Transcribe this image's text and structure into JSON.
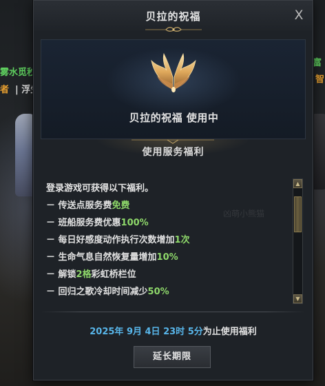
{
  "world": {
    "text_green_left": "雾水觅秒",
    "text_orange_left": "者",
    "text_sep_left": "| 浮生",
    "text_green_right": "富",
    "text_orange_right": "智"
  },
  "dialog": {
    "title": "贝拉的祝福",
    "close_label": "X",
    "banner": {
      "icon": "angel-wings-icon",
      "status": "贝拉的祝福 使用中"
    },
    "section_title": "使用服务福利",
    "watermark": "凶萌小熊猫",
    "benefits_intro": "登录游戏可获得以下福利。",
    "benefits": [
      {
        "prefix": "－ 传送点服务费",
        "highlight": "免费",
        "suffix": ""
      },
      {
        "prefix": "－ 班船服务费优惠",
        "highlight": "100%",
        "suffix": ""
      },
      {
        "prefix": "－ 每日好感度动作执行次数增加",
        "highlight": "1次",
        "suffix": ""
      },
      {
        "prefix": "－ 生命气息自然恢复量增加",
        "highlight": "10%",
        "suffix": ""
      },
      {
        "prefix": "－ 解锁",
        "highlight": "2格",
        "suffix": "彩虹桥栏位"
      },
      {
        "prefix": "－ 回归之歌冷却时间减少",
        "highlight": "50%",
        "suffix": ""
      }
    ],
    "scrollbar": {
      "position": 0.1
    },
    "expiry": {
      "date": "2025年 9月 4日 23时 5分",
      "suffix": "为止使用福利"
    },
    "extend_button": "延长期限"
  },
  "colors": {
    "highlight_green": "#8ed86a",
    "date_blue": "#58b6ea",
    "ornament_gold": "#b89a5a"
  }
}
